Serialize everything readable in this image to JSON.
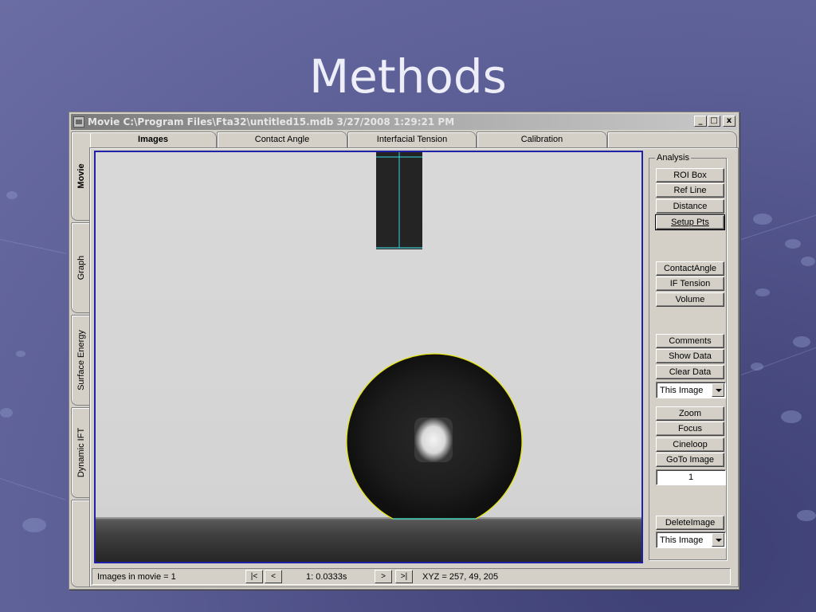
{
  "slide": {
    "title": "Methods"
  },
  "window": {
    "title": "Movie C:\\Program Files\\Fta32\\untitled15.mdb 3/27/2008 1:29:21 PM",
    "minimize": "_",
    "maximize": "□",
    "close": "x"
  },
  "top_tabs": [
    "Images",
    "Contact Angle",
    "Interfacial Tension",
    "Calibration"
  ],
  "side_tabs": [
    "Movie",
    "Graph",
    "Surface Energy",
    "Dynamic IFT"
  ],
  "analysis": {
    "group_label": "Analysis",
    "roi_box": "ROI Box",
    "ref_line": "Ref Line",
    "distance": "Distance",
    "setup_pts": "Setup Pts",
    "contact_angle": "ContactAngle",
    "if_tension": "IF Tension",
    "volume": "Volume",
    "comments": "Comments",
    "show_data": "Show Data",
    "clear_data": "Clear Data",
    "scope_select_1": "This Image",
    "zoom": "Zoom",
    "focus": "Focus",
    "cineloop": "Cineloop",
    "goto_image": "GoTo Image",
    "frame_number": "1",
    "delete_image": "DeleteImage",
    "scope_select_2": "This Image"
  },
  "status": {
    "images_in_movie": "Images in movie = 1",
    "first": "|<",
    "prev": "<",
    "frame_time": "1:  0.0333s",
    "next": ">",
    "last": ">|",
    "xyz": "XYZ = 257, 49, 205"
  },
  "colors": {
    "selection_border": "#2020a8",
    "drop_outline": "#e8e800",
    "ref_line": "#30d8e0"
  },
  "icons": {
    "window_icon": "app-icon"
  }
}
